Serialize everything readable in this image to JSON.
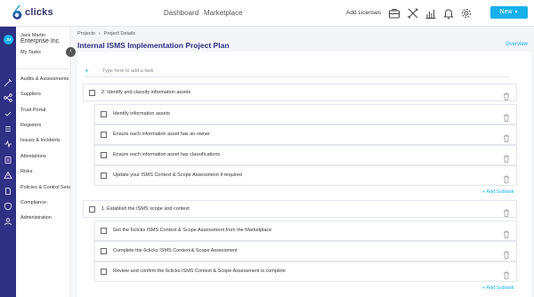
{
  "header": {
    "logo_glyph": "6",
    "logo_text": "clicks",
    "nav": [
      "Dashboard",
      "Marketplace"
    ],
    "add_licenses": "Add Licenses",
    "new_button": "New",
    "icons": [
      "briefcase-icon",
      "tools-icon",
      "chart-icon",
      "bell-icon",
      "gear-icon"
    ]
  },
  "sidebar": {
    "user_initials": "JM",
    "user_name": "Jack Martin",
    "org": "Enterprise Inc",
    "items": [
      {
        "label": "My Tasks",
        "icon": "tasks-icon"
      },
      {
        "label": "Audits & Assessments",
        "icon": "audit-icon"
      },
      {
        "label": "Suppliers",
        "icon": "suppliers-icon"
      },
      {
        "label": "Trust Portal",
        "icon": "trust-icon"
      },
      {
        "label": "Registers",
        "icon": "registers-icon"
      },
      {
        "label": "Issues & Incidents",
        "icon": "issues-icon"
      },
      {
        "label": "Attestations",
        "icon": "attestations-icon"
      },
      {
        "label": "Risks",
        "icon": "risks-icon"
      },
      {
        "label": "Policies & Control Sets",
        "icon": "policies-icon"
      },
      {
        "label": "Compliance",
        "icon": "compliance-icon"
      },
      {
        "label": "Administration",
        "icon": "admin-icon"
      }
    ]
  },
  "main": {
    "breadcrumb": [
      "Projects",
      "Project Details"
    ],
    "breadcrumb_sep": "›",
    "title": "Internal ISMS Implementation Project Plan",
    "overview_link": "Overview",
    "new_task_placeholder": "Type here to add a task",
    "tasks": [
      {
        "label": "2. Identify and classify information assets",
        "level": 0
      },
      {
        "label": "Identify information assets",
        "level": 1
      },
      {
        "label": "Ensure each information asset has an owner",
        "level": 1
      },
      {
        "label": "Ensure each information asset has classifications",
        "level": 1
      },
      {
        "label": "Update your ISMS Context & Scope Assessment if required",
        "level": 1
      },
      {
        "label": "1. Establish the ISMS scope and context",
        "level": 0
      },
      {
        "label": "Get the 6clicks ISMS Context & Scope Assessment from the Marketplace",
        "level": 1
      },
      {
        "label": "Complete the 6clicks ISMS Context & Scope Assessment",
        "level": 1
      },
      {
        "label": "Review and confirm the 6clicks ISMS Context & Scope Assessment is complete",
        "level": 1
      }
    ],
    "add_subtask": "+ Add Subtask"
  }
}
